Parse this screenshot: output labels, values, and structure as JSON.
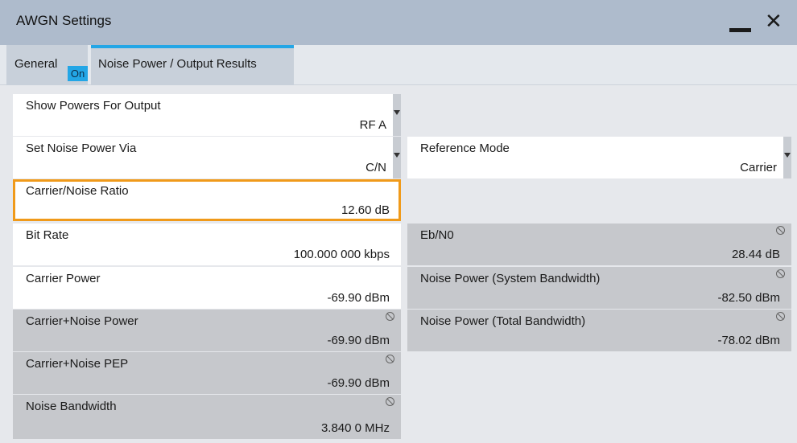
{
  "window": {
    "title": "AWGN Settings"
  },
  "tabs": {
    "general": {
      "label": "General",
      "badge": "On"
    },
    "noise": {
      "label": "Noise Power / Output Results"
    }
  },
  "fields": {
    "show_powers": {
      "label": "Show Powers For Output",
      "value": "RF A"
    },
    "set_noise_via": {
      "label": "Set Noise Power Via",
      "value": "C/N"
    },
    "reference_mode": {
      "label": "Reference Mode",
      "value": "Carrier"
    },
    "cn_ratio": {
      "label": "Carrier/Noise Ratio",
      "value": "12.60 dB"
    },
    "bit_rate": {
      "label": "Bit Rate",
      "value": "100.000 000 kbps"
    },
    "eb_n0": {
      "label": "Eb/N0",
      "value": "28.44 dB"
    },
    "carrier_power": {
      "label": "Carrier Power",
      "value": "-69.90 dBm"
    },
    "noise_sys_bw": {
      "label": "Noise Power (System Bandwidth)",
      "value": "-82.50 dBm"
    },
    "cn_power": {
      "label": "Carrier+Noise Power",
      "value": "-69.90 dBm"
    },
    "noise_total_bw": {
      "label": "Noise Power (Total Bandwidth)",
      "value": "-78.02 dBm"
    },
    "cn_pep": {
      "label": "Carrier+Noise PEP",
      "value": "-69.90 dBm"
    },
    "noise_bandwidth": {
      "label": "Noise Bandwidth",
      "value": "3.840 0 MHz"
    }
  }
}
